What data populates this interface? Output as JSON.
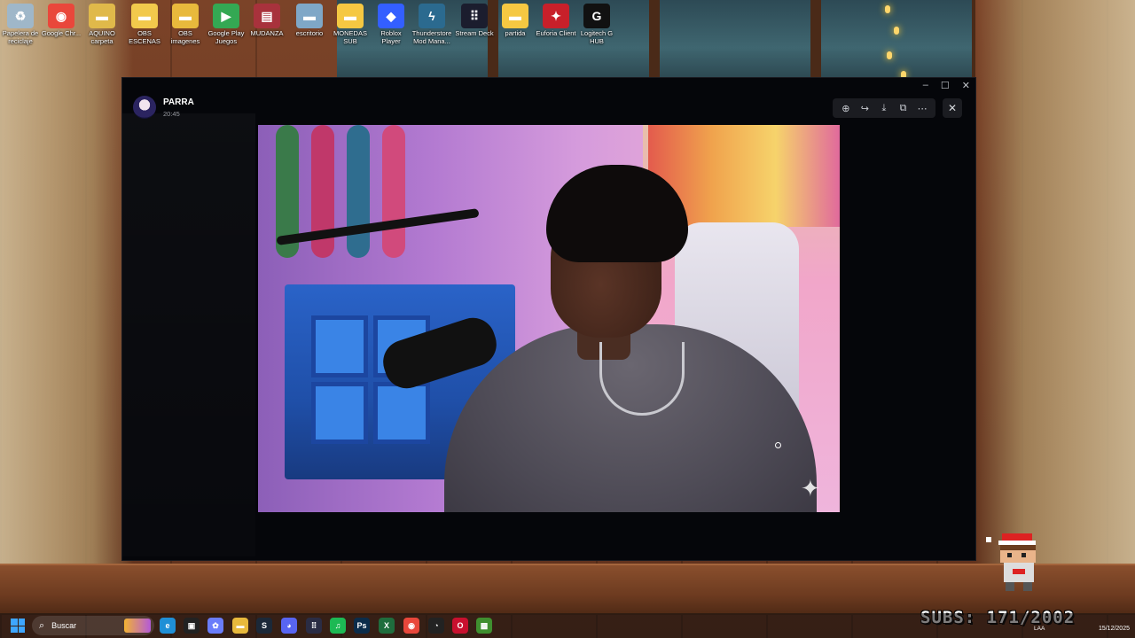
{
  "desktop": {
    "icons": [
      {
        "name": "recycle-bin-icon",
        "label": "Papelera de reciclaje",
        "glyph": "♻",
        "color": "#9fb7c9"
      },
      {
        "name": "chrome-icon",
        "label": "Google Chr...",
        "glyph": "◉",
        "color": "#e9473b"
      },
      {
        "name": "folder-aquino-icon",
        "label": "AQUINO carpeta",
        "glyph": "▬",
        "color": "#e0b94a"
      },
      {
        "name": "folder-obs-escenas-icon",
        "label": "OBS ESCENAS",
        "glyph": "▬",
        "color": "#f2c94c"
      },
      {
        "name": "folder-obs-imagenes-icon",
        "label": "OBS imagenes",
        "glyph": "▬",
        "color": "#e8b93c"
      },
      {
        "name": "google-play-games-icon",
        "label": "Google Play Juegos",
        "glyph": "▶",
        "color": "#34a853"
      },
      {
        "name": "winrar-icon",
        "label": "MUDANZA",
        "glyph": "▤",
        "color": "#a8323c"
      },
      {
        "name": "folder-escritorio-icon",
        "label": "escritorio",
        "glyph": "▬",
        "color": "#7fa7c7"
      },
      {
        "name": "folder-monedas-icon",
        "label": "MONEDAS SUB",
        "glyph": "▬",
        "color": "#f5c842"
      },
      {
        "name": "roblox-icon",
        "label": "Roblox Player",
        "glyph": "◆",
        "color": "#335fff"
      },
      {
        "name": "thunderstore-icon",
        "label": "Thunderstore Mod Mana...",
        "glyph": "ϟ",
        "color": "#2b6a8f"
      },
      {
        "name": "stream-deck-icon",
        "label": "Stream Deck",
        "glyph": "⠿",
        "color": "#1b1d2e"
      },
      {
        "name": "folder-partida-icon",
        "label": "partida",
        "glyph": "▬",
        "color": "#f5c842"
      },
      {
        "name": "euforia-client-icon",
        "label": "Euforia Client",
        "glyph": "✦",
        "color": "#c8202a"
      },
      {
        "name": "logitech-ghub-icon",
        "label": "Logitech G HUB",
        "glyph": "G",
        "color": "#111111"
      }
    ]
  },
  "viewer": {
    "author": "PARRA",
    "time": "20:45",
    "toolbar": {
      "zoom": "⊕",
      "forward": "↪",
      "download": "⤓",
      "open": "⧉",
      "more": "⋯"
    },
    "close": "✕",
    "window_controls": {
      "minimize": "–",
      "maximize": "☐",
      "close": "✕"
    }
  },
  "overlay": {
    "subs_text": "SUBS: 171/2002"
  },
  "taskbar": {
    "search_placeholder": "Buscar",
    "apps": [
      {
        "name": "taskbar-edge-icon",
        "glyph": "e",
        "color": "#1f8fd6"
      },
      {
        "name": "taskbar-roblox-studio-icon",
        "glyph": "▣",
        "color": "#222"
      },
      {
        "name": "taskbar-copilot-icon",
        "glyph": "✿",
        "color": "#6a7dfb"
      },
      {
        "name": "taskbar-file-explorer-icon",
        "glyph": "▬",
        "color": "#e8b93c"
      },
      {
        "name": "taskbar-steam-icon",
        "glyph": "S",
        "color": "#1b2838"
      },
      {
        "name": "taskbar-discord-icon",
        "glyph": "◕",
        "color": "#5865f2"
      },
      {
        "name": "taskbar-stream-deck-icon",
        "glyph": "⠿",
        "color": "#2a2c44"
      },
      {
        "name": "taskbar-spotify-icon",
        "glyph": "♫",
        "color": "#1db954"
      },
      {
        "name": "taskbar-photoshop-icon",
        "glyph": "Ps",
        "color": "#0b2c4a"
      },
      {
        "name": "taskbar-excel-icon",
        "glyph": "X",
        "color": "#1f6d3d"
      },
      {
        "name": "taskbar-chrome-icon",
        "glyph": "◉",
        "color": "#e9473b"
      },
      {
        "name": "taskbar-github-icon",
        "glyph": "◔",
        "color": "#222"
      },
      {
        "name": "taskbar-opera-icon",
        "glyph": "O",
        "color": "#c8102e"
      },
      {
        "name": "taskbar-minecraft-icon",
        "glyph": "▩",
        "color": "#3f8f2f"
      }
    ],
    "lang": "LAA",
    "date": "15/12/2025"
  }
}
